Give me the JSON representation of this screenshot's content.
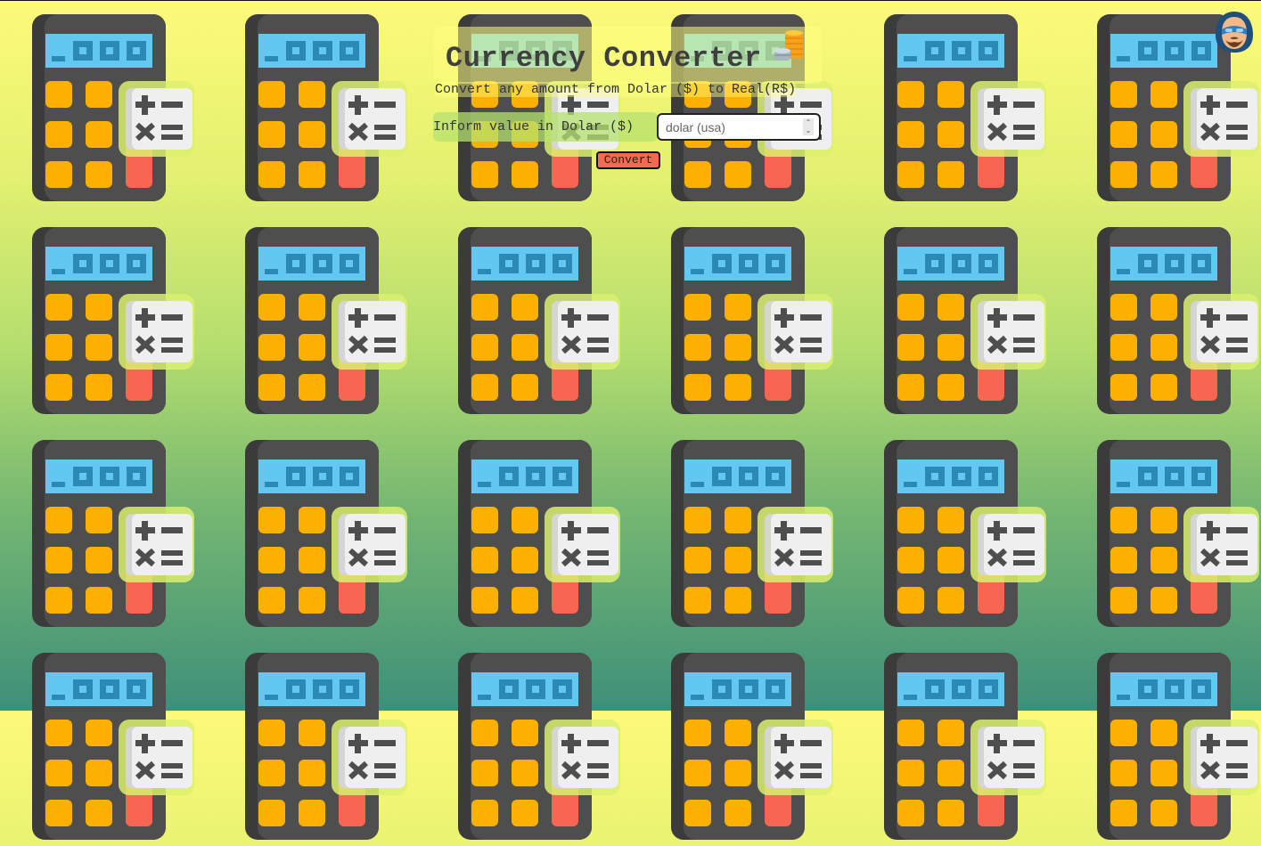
{
  "header": {
    "title": "Currency Converter",
    "subtitle": "Convert any amount from Dolar ($) to Real(R$)"
  },
  "form": {
    "input_label": "Inform value in Dolar ($)",
    "input_value": "",
    "input_placeholder": "dolar (usa)",
    "convert_label": "Convert"
  },
  "icons": {
    "coins": "coins-stack-icon",
    "avatar": "user-avatar-icon",
    "background_tile": "calculator-icon"
  },
  "colors": {
    "gradient_top": "#fdfa78",
    "gradient_bottom": "#3d8f79",
    "button": "#f26a4f",
    "calc_body": "#4e4e4e",
    "calc_screen": "#62c8f0",
    "calc_key": "#fcb000",
    "calc_key_red": "#f86652"
  }
}
